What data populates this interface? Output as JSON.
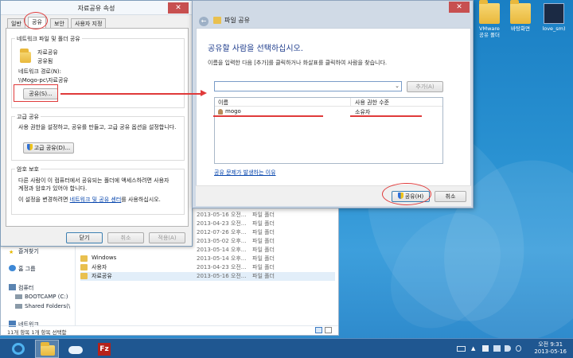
{
  "desktop": {
    "icons": [
      {
        "label": "VMware\n공유 폴더"
      },
      {
        "label": "바탕화면"
      },
      {
        "label": "love_sm)"
      }
    ]
  },
  "explorer": {
    "nav": [
      {
        "label": "즐겨찾기"
      },
      {
        "label": "홈 그룹"
      },
      {
        "label": "컴퓨터"
      },
      {
        "label": "BOOTCAMP (C:)"
      },
      {
        "label": "Shared Folders(\\"
      },
      {
        "label": "네트워크"
      }
    ],
    "status": "11개 항목    1개 항목 선택함",
    "rows": [
      {
        "name": "",
        "date": "2013-05-16 오전...",
        "type": "파일 폴더"
      },
      {
        "name": "",
        "date": "2013-04-23 오전...",
        "type": "파일 폴더"
      },
      {
        "name": "",
        "date": "2012-07-26 오후...",
        "type": "파일 폴더"
      },
      {
        "name": "",
        "date": "2013-05-02 오후...",
        "type": "파일 폴더"
      },
      {
        "name": "",
        "date": "2013-05-14 오후...",
        "type": "파일 폴더"
      },
      {
        "name": "Windows",
        "date": "2013-05-14 오후...",
        "type": "파일 폴더"
      },
      {
        "name": "사용자",
        "date": "2013-04-23 오전...",
        "type": "파일 폴더"
      },
      {
        "name": "자료공유",
        "date": "2013-05-16 오전...",
        "type": "파일 폴더"
      }
    ]
  },
  "props": {
    "title": "자료공유 속성",
    "close": "✕",
    "tabs": [
      "일반",
      "공유",
      "보안",
      "사용자 지정"
    ],
    "net_group": "네트워크 파일 및 폴더 공유",
    "folder_name": "자료공유",
    "folder_state": "공유됨",
    "path_label": "네트워크 경로(N):",
    "path_value": "\\\\Mogo-pc\\자료공유",
    "share_btn": "공유(S)...",
    "adv_group": "고급 공유",
    "adv_desc": "사용 권한을 설정하고, 공유를 만들고, 고급 공유 옵션을 설정합니다.",
    "adv_btn": "고급 공유(D)...",
    "pw_group": "암호 보호",
    "pw_desc1": "다른 사람이 이 컴퓨터에서 공유되는 폴더에 액세스하려면 사용자",
    "pw_desc2": "계정과 암호가 있어야 합니다.",
    "pw_link_pre": "이 설정을 변경하려면 ",
    "pw_link": "네트워크 및 공유 센터",
    "pw_link_post": "를 사용하십시오.",
    "ok": "닫기",
    "cancel": "취소",
    "apply": "적용(A)"
  },
  "wizard": {
    "title": "파일 공유",
    "close": "✕",
    "back": "←",
    "heading": "공유할 사람을 선택하십시오.",
    "instruction": "이름을 입력한 다음 [추가]를 클릭하거나 화살표를 클릭하여 사람을 찾습니다.",
    "add_btn": "추가(A)",
    "col_name": "이름",
    "col_perm": "사용 권한 수준",
    "users": [
      {
        "name": "mogo",
        "perm": "소유자"
      }
    ],
    "help_link": "공유 문제가 발생하는 이유",
    "share_btn": "공유(H)",
    "cancel_btn": "취소"
  },
  "taskbar": {
    "time": "오전 9:31",
    "date": "2013-05-16"
  }
}
